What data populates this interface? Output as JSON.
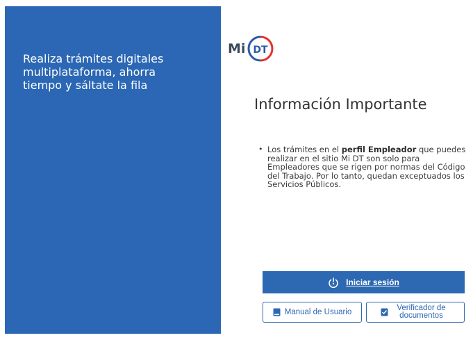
{
  "sidebar": {
    "tagline": "Realiza trámites digitales multiplataforma, ahorra tiempo y sáltate la fila"
  },
  "logo": {
    "prefix": "Mi",
    "badge": "DT"
  },
  "main": {
    "title": "Información Importante",
    "info": {
      "bullet": "•",
      "before_bold": "Los trámites en el ",
      "bold": "perfil Empleador",
      "after_bold": " que puedes realizar en el sitio Mi DT son solo para Empleadores que se rigen por normas del Código del Trabajo. Por lo tanto, quedan exceptuados los Servicios Públicos."
    }
  },
  "actions": {
    "login_label": "Iniciar sesión",
    "manual_label": "Manual de Usuario",
    "verifier_label": "Verificador de documentos"
  },
  "colors": {
    "panel_blue": "#2b67b4",
    "button_blue": "#2d68b3",
    "logo_red": "#e3312d",
    "logo_blue": "#2a5aa6"
  },
  "icons": {
    "login": "power-icon",
    "manual": "book-icon",
    "verifier": "document-check-icon"
  }
}
